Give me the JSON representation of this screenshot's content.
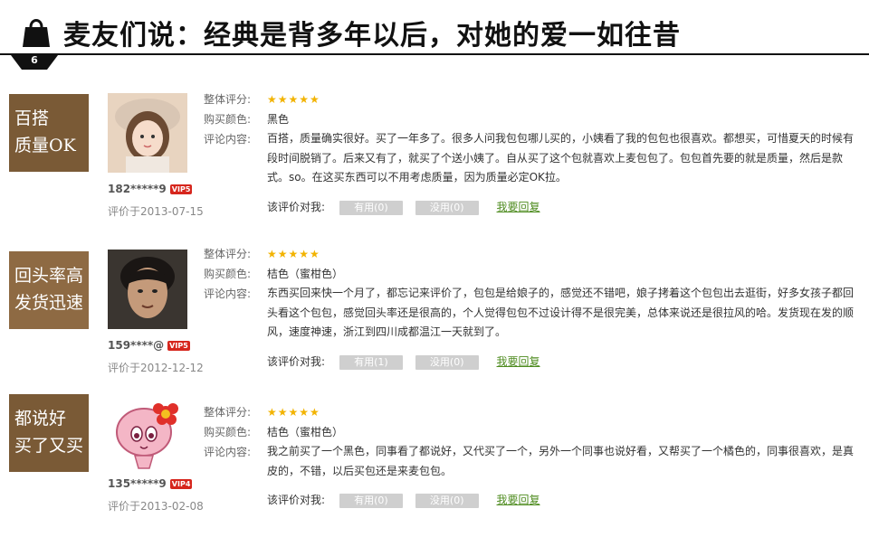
{
  "header": {
    "title": "麦友们说：经典是背多年以后，对她的爱一如往昔",
    "page_number": "6"
  },
  "labels": {
    "rating": "整体评分:",
    "color": "购买颜色:",
    "content": "评论内容:",
    "vote_prompt": "该评价对我:",
    "reply": "我要回复",
    "stars": "★★★★★"
  },
  "reviews": [
    {
      "tag_line1": "百搭",
      "tag_line2": "质量OK",
      "username": "182*****9",
      "vip": "VIP5",
      "date": "评价于2013-07-15",
      "color": "黑色",
      "rating": 5,
      "content": "百搭，质量确实很好。买了一年多了。很多人问我包包哪儿买的，小姨看了我的包包也很喜欢。都想买，可惜夏天的时候有段时间脱销了。后来又有了，就买了个送小姨了。自从买了这个包就喜欢上麦包包了。包包首先要的就是质量，然后是款式。so。在这买东西可以不用考虑质量，因为质量必定OK拉。",
      "useful": "有用(0)",
      "useless": "没用(0)"
    },
    {
      "tag_line1": "回头率高",
      "tag_line2": "发货迅速",
      "username": "159****@",
      "vip": "VIP5",
      "date": "评价于2012-12-12",
      "color": "桔色（蜜柑色）",
      "rating": 5,
      "content": "东西买回来快一个月了，都忘记来评价了，包包是给娘子的，感觉还不错吧，娘子拷着这个包包出去逛街，好多女孩子都回头看这个包包，感觉回头率还是很高的，个人觉得包包不过设计得不是很完美，总体来说还是很拉风的哈。发货现在发的顺风，速度神速，浙江到四川成都温江一天就到了。",
      "useful": "有用(1)",
      "useless": "没用(0)"
    },
    {
      "tag_line1": "都说好",
      "tag_line2": "买了又买",
      "username": "135*****9",
      "vip": "VIP4",
      "date": "评价于2013-02-08",
      "color": "桔色（蜜柑色）",
      "rating": 5,
      "content": "我之前买了一个黑色，同事看了都说好，又代买了一个，另外一个同事也说好看，又帮买了一个橘色的，同事很喜欢，是真皮的，不错，以后买包还是来麦包包。",
      "useful": "有用(0)",
      "useless": "没用(0)"
    }
  ],
  "colors": {
    "tag_dark": "#7a5a36",
    "tag_mid": "#8e6a43",
    "star": "#f2b300",
    "vip": "#d6261d",
    "reply_link": "#4d8b1e",
    "button_bg": "#cfcfcf"
  }
}
